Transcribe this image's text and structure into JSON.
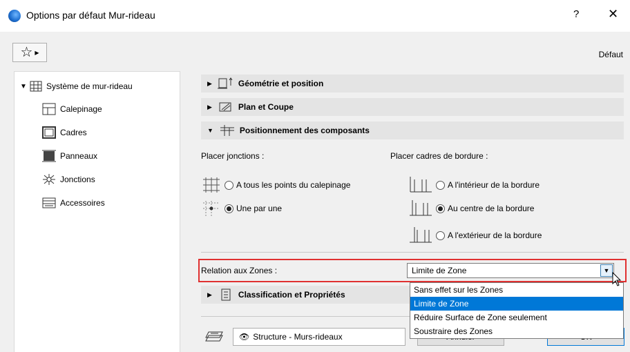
{
  "window": {
    "title": "Options par défaut Mur-rideau",
    "help": "?",
    "close": "✕"
  },
  "toolbar": {
    "favorites_icon": "star-icon",
    "default_label": "Défaut"
  },
  "sidebar": {
    "root": "Système de mur-rideau",
    "items": [
      {
        "label": "Calepinage",
        "icon": "grid-scheme-icon"
      },
      {
        "label": "Cadres",
        "icon": "frame-icon"
      },
      {
        "label": "Panneaux",
        "icon": "panel-icon"
      },
      {
        "label": "Jonctions",
        "icon": "junction-icon"
      },
      {
        "label": "Accessoires",
        "icon": "accessory-icon"
      }
    ]
  },
  "sections": {
    "geometry": "Géométrie et position",
    "plan": "Plan et Coupe",
    "positioning": "Positionnement des composants",
    "classification": "Classification et Propriétés"
  },
  "positioning": {
    "junctions_label": "Placer jonctions :",
    "junction_options": [
      "A tous les points du calepinage",
      "Une par une"
    ],
    "junction_selected": 1,
    "border_label": "Placer cadres de bordure :",
    "border_options": [
      "A l'intérieur de la bordure",
      "Au centre de la bordure",
      "A l'extérieur de la bordure"
    ],
    "border_selected": 1
  },
  "zones": {
    "label": "Relation aux Zones :",
    "value": "Limite de Zone",
    "options": [
      "Sans effet sur les Zones",
      "Limite de Zone",
      "Réduire Surface de Zone seulement",
      "Soustraire des Zones"
    ],
    "selected_index": 1
  },
  "footer": {
    "layer_value": "Structure - Murs-rideaux",
    "cancel_partial": "Annuler",
    "ok_partial": "OK"
  },
  "colors": {
    "highlight": "#0078d7",
    "focus_border": "#e03030",
    "section_bg": "#e4e4e4"
  }
}
